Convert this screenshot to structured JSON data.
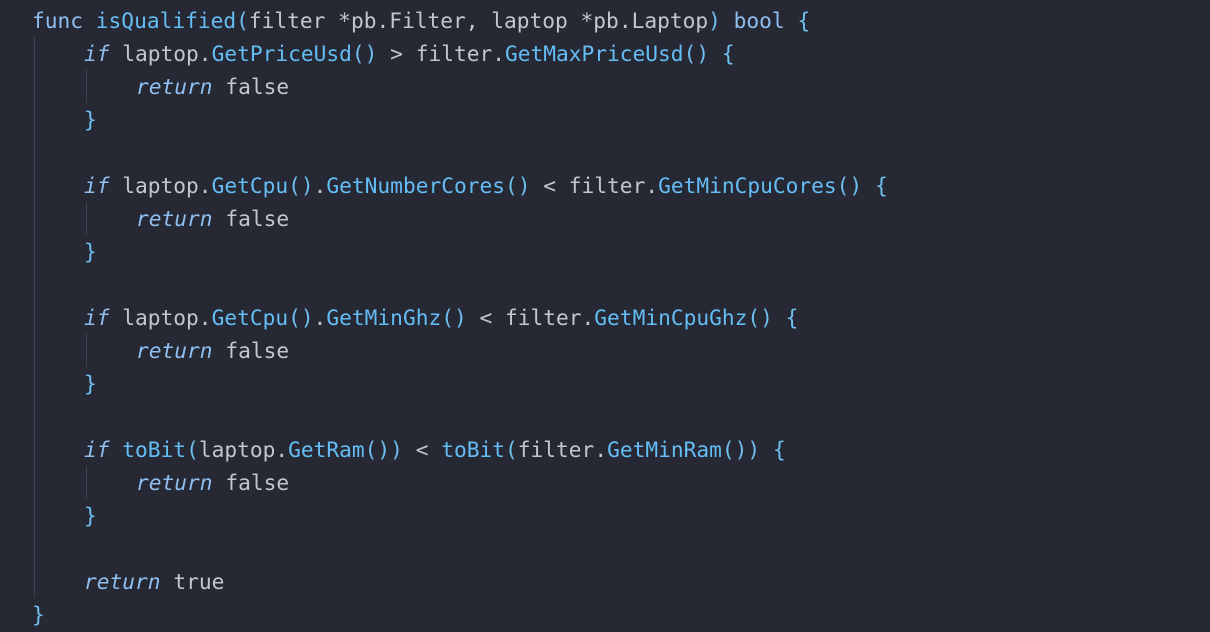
{
  "editor": {
    "colors": {
      "background": "#262833",
      "keyword": "#8fbff0",
      "function": "#64bdf5",
      "identifier": "#c3c6cf",
      "bracket": "#6fc0f0",
      "indent_guide": "#3e4150"
    },
    "lines": [
      {
        "indent": 0,
        "tokens": [
          {
            "t": "func",
            "c": "kw"
          },
          {
            "t": " ",
            "c": "pl"
          },
          {
            "t": "isQualified",
            "c": "fn"
          },
          {
            "t": "(",
            "c": "br"
          },
          {
            "t": "filter *pb.Filter, laptop *pb.Laptop",
            "c": "id"
          },
          {
            "t": ")",
            "c": "br"
          },
          {
            "t": " ",
            "c": "pl"
          },
          {
            "t": "bool",
            "c": "kw"
          },
          {
            "t": " ",
            "c": "pl"
          },
          {
            "t": "{",
            "c": "br"
          }
        ]
      },
      {
        "indent": 1,
        "tokens": [
          {
            "t": "if",
            "c": "kwi"
          },
          {
            "t": " laptop.",
            "c": "id"
          },
          {
            "t": "GetPriceUsd",
            "c": "fn"
          },
          {
            "t": "()",
            "c": "br"
          },
          {
            "t": " > filter.",
            "c": "op"
          },
          {
            "t": "GetMaxPriceUsd",
            "c": "fn"
          },
          {
            "t": "()",
            "c": "br"
          },
          {
            "t": " ",
            "c": "pl"
          },
          {
            "t": "{",
            "c": "br"
          }
        ]
      },
      {
        "indent": 2,
        "tokens": [
          {
            "t": "return",
            "c": "kwi"
          },
          {
            "t": " ",
            "c": "pl"
          },
          {
            "t": "false",
            "c": "id"
          }
        ]
      },
      {
        "indent": 1,
        "tokens": [
          {
            "t": "}",
            "c": "br"
          }
        ]
      },
      {
        "indent": 0,
        "tokens": []
      },
      {
        "indent": 1,
        "tokens": [
          {
            "t": "if",
            "c": "kwi"
          },
          {
            "t": " laptop.",
            "c": "id"
          },
          {
            "t": "GetCpu",
            "c": "fn"
          },
          {
            "t": "()",
            "c": "br"
          },
          {
            "t": ".",
            "c": "id"
          },
          {
            "t": "GetNumberCores",
            "c": "fn"
          },
          {
            "t": "()",
            "c": "br"
          },
          {
            "t": " < filter.",
            "c": "op"
          },
          {
            "t": "GetMinCpuCores",
            "c": "fn"
          },
          {
            "t": "()",
            "c": "br"
          },
          {
            "t": " ",
            "c": "pl"
          },
          {
            "t": "{",
            "c": "br"
          }
        ]
      },
      {
        "indent": 2,
        "tokens": [
          {
            "t": "return",
            "c": "kwi"
          },
          {
            "t": " ",
            "c": "pl"
          },
          {
            "t": "false",
            "c": "id"
          }
        ]
      },
      {
        "indent": 1,
        "tokens": [
          {
            "t": "}",
            "c": "br"
          }
        ]
      },
      {
        "indent": 0,
        "tokens": []
      },
      {
        "indent": 1,
        "tokens": [
          {
            "t": "if",
            "c": "kwi"
          },
          {
            "t": " laptop.",
            "c": "id"
          },
          {
            "t": "GetCpu",
            "c": "fn"
          },
          {
            "t": "()",
            "c": "br"
          },
          {
            "t": ".",
            "c": "id"
          },
          {
            "t": "GetMinGhz",
            "c": "fn"
          },
          {
            "t": "()",
            "c": "br"
          },
          {
            "t": " < filter.",
            "c": "op"
          },
          {
            "t": "GetMinCpuGhz",
            "c": "fn"
          },
          {
            "t": "()",
            "c": "br"
          },
          {
            "t": " ",
            "c": "pl"
          },
          {
            "t": "{",
            "c": "br"
          }
        ]
      },
      {
        "indent": 2,
        "tokens": [
          {
            "t": "return",
            "c": "kwi"
          },
          {
            "t": " ",
            "c": "pl"
          },
          {
            "t": "false",
            "c": "id"
          }
        ]
      },
      {
        "indent": 1,
        "tokens": [
          {
            "t": "}",
            "c": "br"
          }
        ]
      },
      {
        "indent": 0,
        "tokens": []
      },
      {
        "indent": 1,
        "tokens": [
          {
            "t": "if",
            "c": "kwi"
          },
          {
            "t": " ",
            "c": "pl"
          },
          {
            "t": "toBit",
            "c": "fn"
          },
          {
            "t": "(",
            "c": "br"
          },
          {
            "t": "laptop.",
            "c": "id"
          },
          {
            "t": "GetRam",
            "c": "fn"
          },
          {
            "t": "())",
            "c": "br"
          },
          {
            "t": " < ",
            "c": "op"
          },
          {
            "t": "toBit",
            "c": "fn"
          },
          {
            "t": "(",
            "c": "br"
          },
          {
            "t": "filter.",
            "c": "id"
          },
          {
            "t": "GetMinRam",
            "c": "fn"
          },
          {
            "t": "())",
            "c": "br"
          },
          {
            "t": " ",
            "c": "pl"
          },
          {
            "t": "{",
            "c": "br"
          }
        ]
      },
      {
        "indent": 2,
        "tokens": [
          {
            "t": "return",
            "c": "kwi"
          },
          {
            "t": " ",
            "c": "pl"
          },
          {
            "t": "false",
            "c": "id"
          }
        ]
      },
      {
        "indent": 1,
        "tokens": [
          {
            "t": "}",
            "c": "br"
          }
        ]
      },
      {
        "indent": 0,
        "tokens": []
      },
      {
        "indent": 1,
        "tokens": [
          {
            "t": "return",
            "c": "kwi"
          },
          {
            "t": " ",
            "c": "pl"
          },
          {
            "t": "true",
            "c": "id"
          }
        ]
      },
      {
        "indent": 0,
        "tokens": [
          {
            "t": "}",
            "c": "br"
          }
        ]
      }
    ]
  }
}
